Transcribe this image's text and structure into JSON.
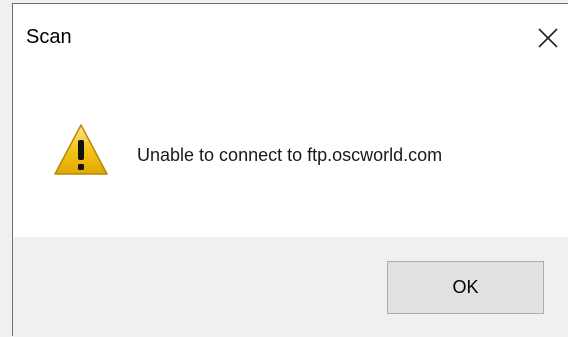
{
  "window": {
    "title": "Scan",
    "close_icon": "close-icon"
  },
  "message": {
    "icon": "warning-icon",
    "text": "Unable to connect to ftp.oscworld.com"
  },
  "buttons": {
    "ok_label": "OK"
  },
  "colors": {
    "warning_fill": "#f5c518",
    "dialog_background": "#ffffff",
    "footer_background": "#f0f0f0"
  }
}
